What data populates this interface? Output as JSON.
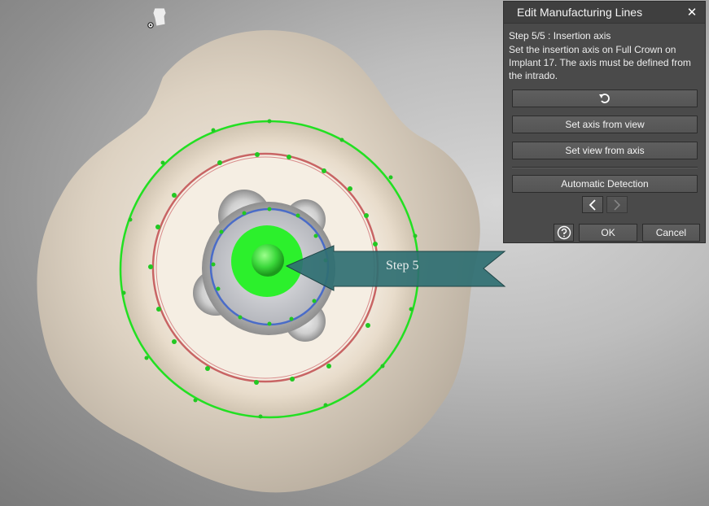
{
  "panel": {
    "title": "Edit Manufacturing Lines",
    "close_icon": "close-icon",
    "step_heading": "Step 5/5 : Insertion axis",
    "step_description": "Set the insertion axis on Full Crown on Implant 17. The axis must be defined from the intrado.",
    "undo_icon": "undo-icon",
    "set_axis_from_view": "Set axis from view",
    "set_view_from_axis": "Set view from axis",
    "automatic_detection": "Automatic Detection",
    "prev_icon": "chevron-left-icon",
    "next_icon": "chevron-right-icon",
    "help_icon": "help-icon",
    "ok": "OK",
    "cancel": "Cancel"
  },
  "viewport": {
    "step_callout": "Step 5",
    "tooth_icon": "tooth-view-icon",
    "colors": {
      "margin_line": "#22e022",
      "intrado_line": "#c86464",
      "inner_line": "#4a6cc8",
      "axis_marker": "#2cf02c",
      "callout_arrow": "#2f6f72"
    }
  }
}
